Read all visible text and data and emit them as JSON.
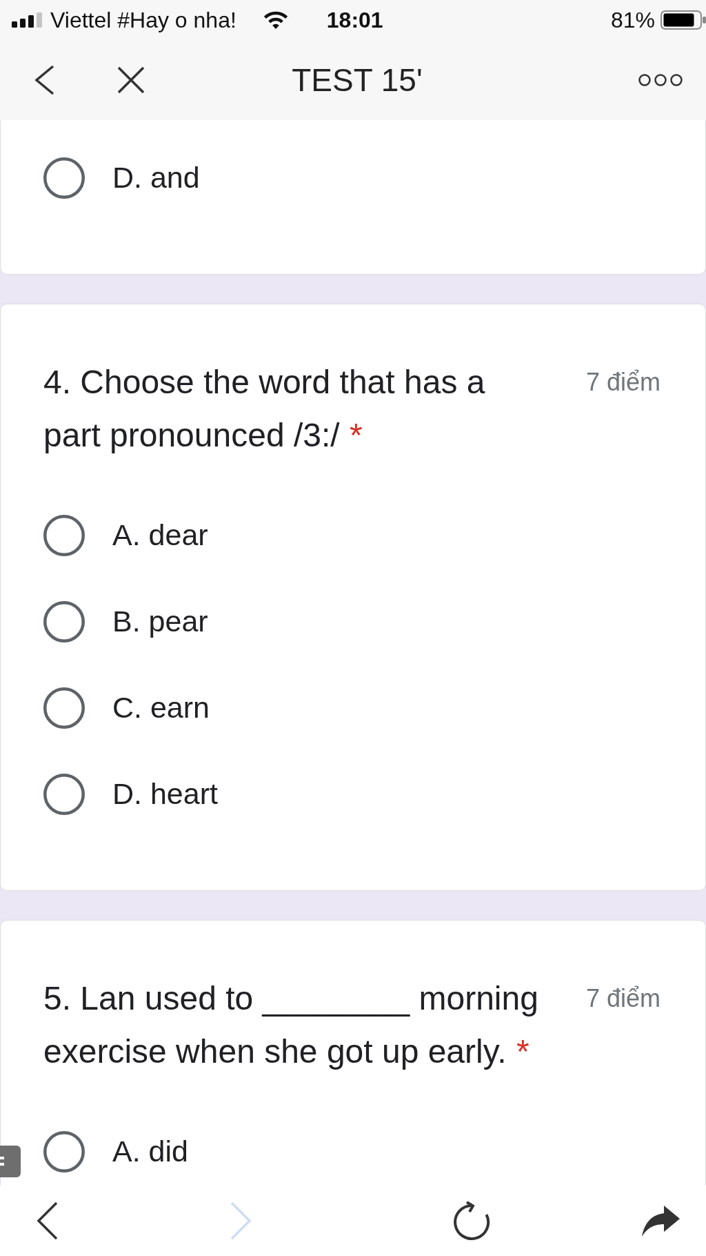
{
  "status_bar": {
    "carrier": "Viettel #Hay o nha!",
    "time": "18:01",
    "battery": "81%"
  },
  "nav_bar": {
    "title": "TEST 15'"
  },
  "cards": [
    {
      "options": [
        {
          "label": "D. and",
          "selected": false
        }
      ]
    },
    {
      "title": "4. Choose the word that has a part pronounced /3:/",
      "required_mark": "*",
      "points": "7 điểm",
      "options": [
        {
          "label": "A. dear",
          "selected": false
        },
        {
          "label": "B. pear",
          "selected": false
        },
        {
          "label": "C. earn",
          "selected": false
        },
        {
          "label": "D. heart",
          "selected": false
        }
      ]
    },
    {
      "title": "5. Lan used to ________ morning exercise when she got up early.",
      "required_mark": "*",
      "points": "7 điểm",
      "options": [
        {
          "label": "A. did",
          "selected": false
        }
      ]
    }
  ],
  "browser_toolbar": [
    {
      "kind": "back",
      "disabled": false
    },
    {
      "kind": "forward",
      "disabled": true
    },
    {
      "kind": "reload",
      "disabled": false
    },
    {
      "kind": "share",
      "disabled": false
    }
  ]
}
